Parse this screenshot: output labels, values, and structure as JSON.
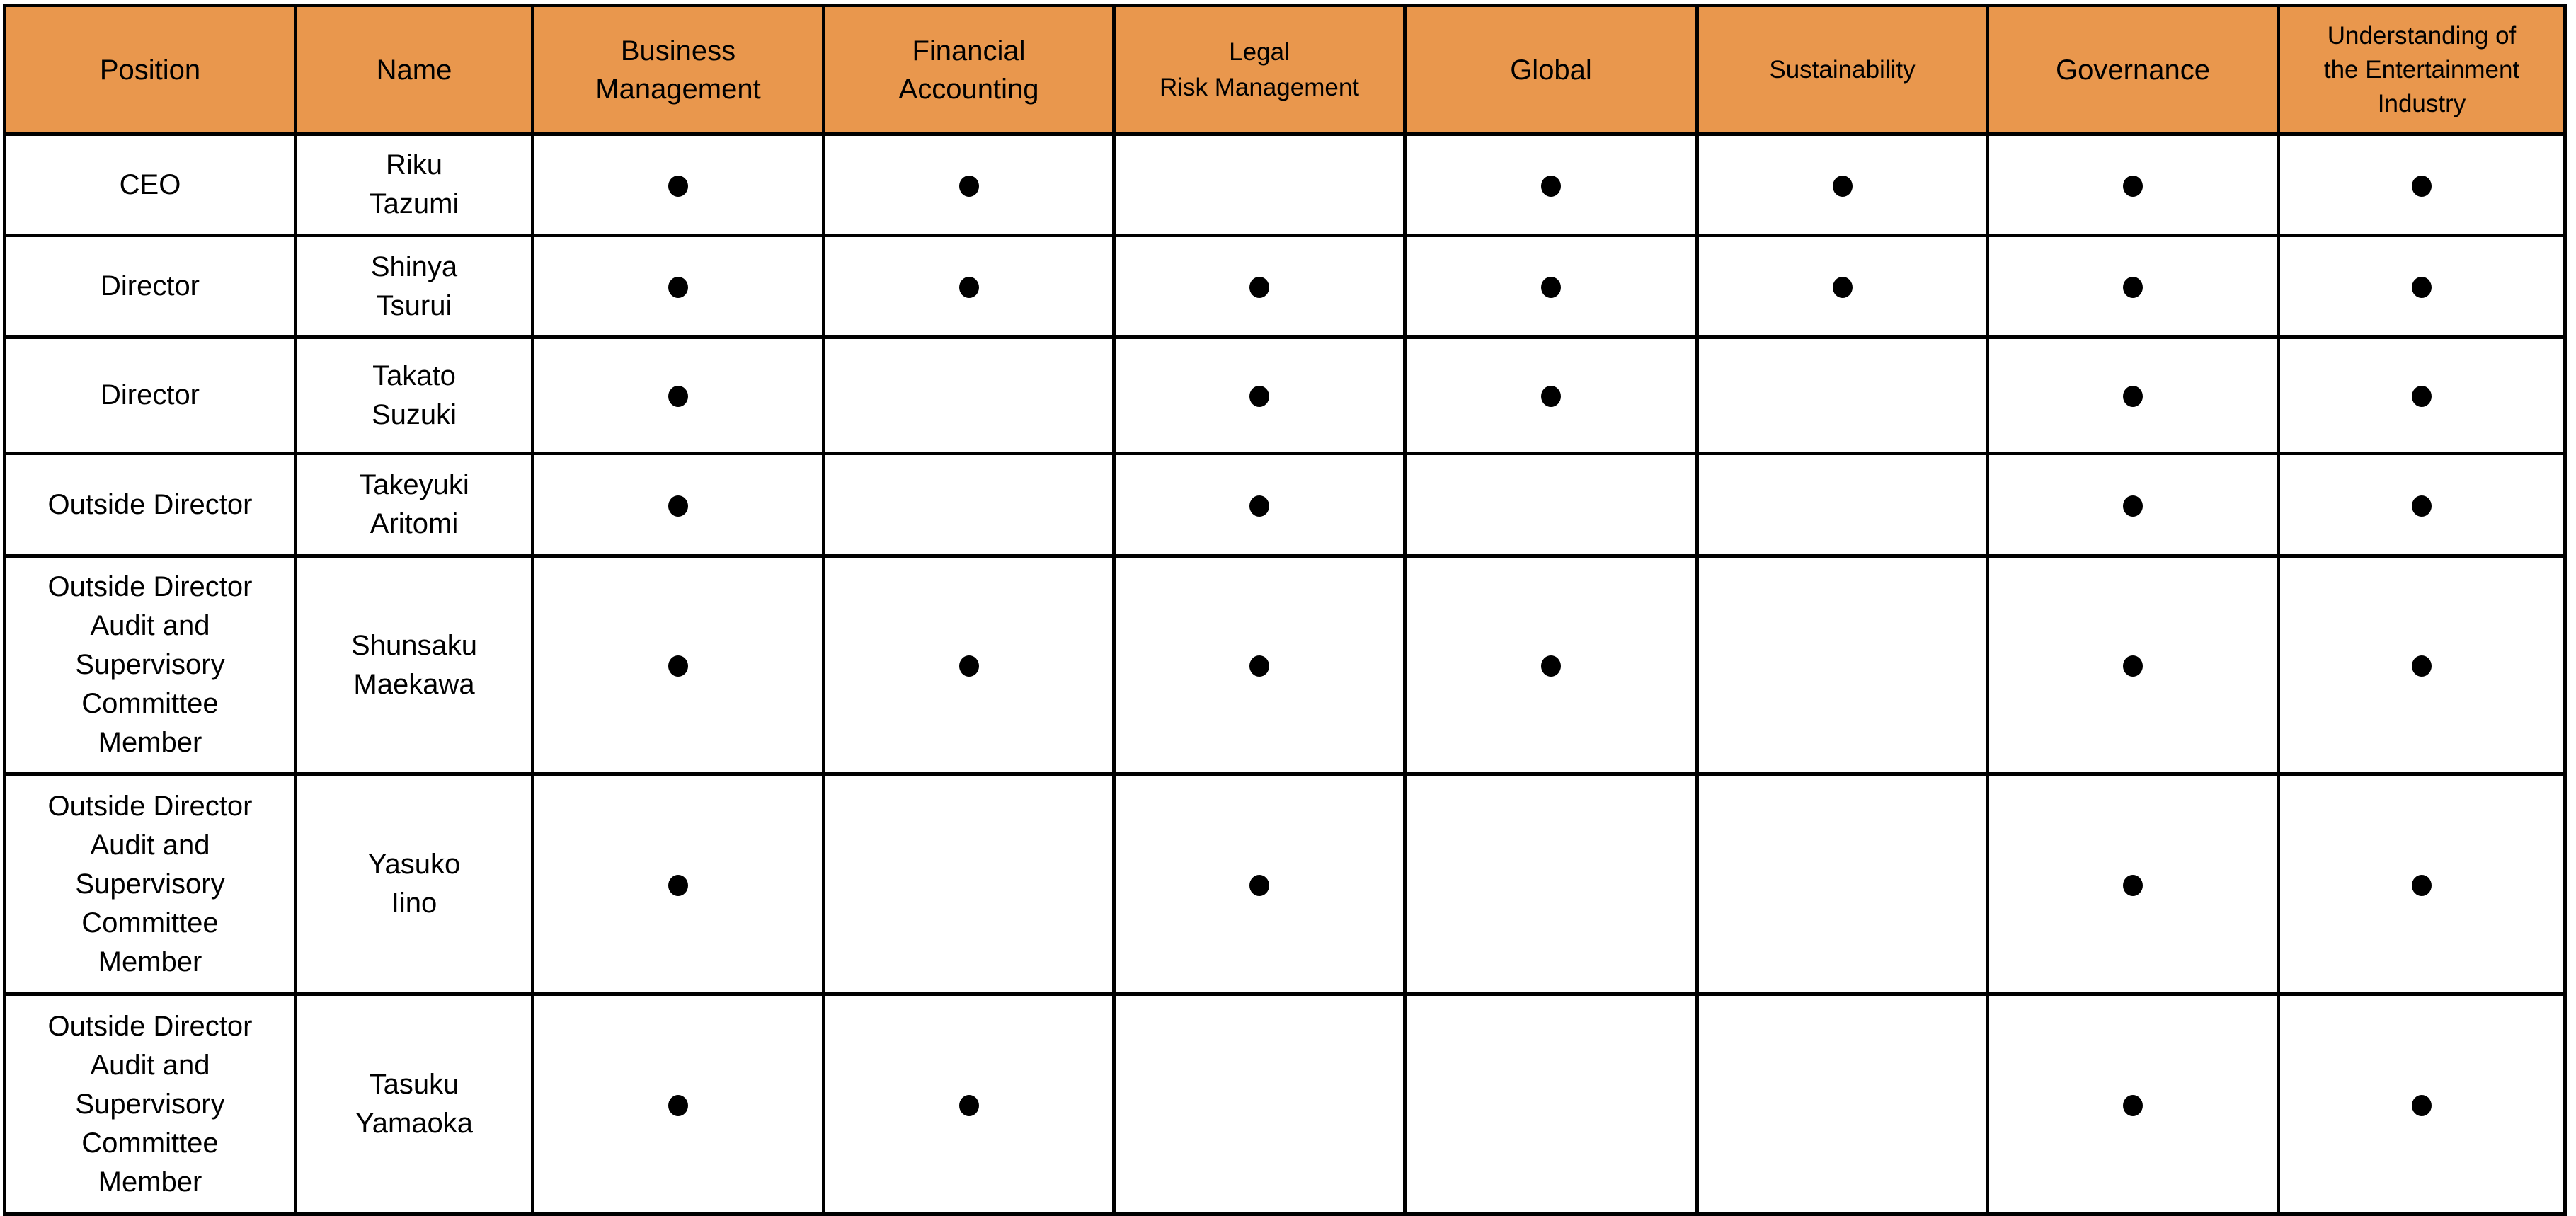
{
  "table": {
    "header_color": "#E9974D",
    "marker_icon": "filled-circle",
    "columns": [
      {
        "key": "position",
        "label": "Position"
      },
      {
        "key": "name",
        "label": "Name"
      },
      {
        "key": "business_management",
        "label": "Business\nManagement"
      },
      {
        "key": "financial_accounting",
        "label": "Financial\nAccounting"
      },
      {
        "key": "legal_risk_management",
        "label": "Legal\nRisk Management"
      },
      {
        "key": "global",
        "label": "Global"
      },
      {
        "key": "sustainability",
        "label": "Sustainability"
      },
      {
        "key": "governance",
        "label": "Governance"
      },
      {
        "key": "entertainment_industry",
        "label": "Understanding of\nthe Entertainment\nIndustry"
      }
    ],
    "rows": [
      {
        "position": "CEO",
        "name": "Riku\nTazumi",
        "skills": [
          true,
          true,
          false,
          true,
          true,
          true,
          true
        ]
      },
      {
        "position": "Director",
        "name": "Shinya\nTsurui",
        "skills": [
          true,
          true,
          true,
          true,
          true,
          true,
          true
        ]
      },
      {
        "position": "Director",
        "name": "Takato\nSuzuki",
        "skills": [
          true,
          false,
          true,
          true,
          false,
          true,
          true
        ]
      },
      {
        "position": "Outside Director",
        "name": "Takeyuki\nAritomi",
        "skills": [
          true,
          false,
          true,
          false,
          false,
          true,
          true
        ]
      },
      {
        "position": "Outside Director\nAudit and\nSupervisory\nCommittee\nMember",
        "name": "Shunsaku\nMaekawa",
        "skills": [
          true,
          true,
          true,
          true,
          false,
          true,
          true
        ]
      },
      {
        "position": "Outside Director\nAudit and\nSupervisory\nCommittee\nMember",
        "name": "Yasuko\nIino",
        "skills": [
          true,
          false,
          true,
          false,
          false,
          true,
          true
        ]
      },
      {
        "position": "Outside Director\nAudit and\nSupervisory\nCommittee\nMember",
        "name": "Tasuku\nYamaoka",
        "skills": [
          true,
          true,
          false,
          false,
          false,
          true,
          true
        ]
      }
    ]
  }
}
